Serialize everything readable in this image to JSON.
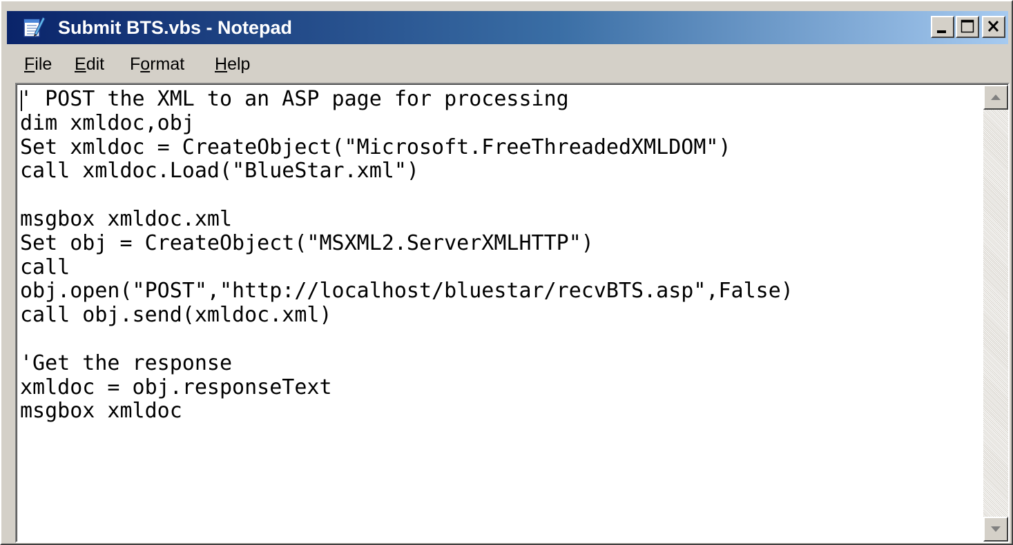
{
  "window": {
    "title": "Submit BTS.vbs - Notepad",
    "title_bar_colors": [
      "#0a246a",
      "#a6caf0"
    ],
    "icon": "notepad-icon",
    "controls": {
      "minimize_icon": "minimize-icon",
      "maximize_icon": "maximize-icon",
      "close_icon": "close-icon"
    }
  },
  "menu": {
    "items": [
      {
        "mnemonic": "F",
        "rest": "ile"
      },
      {
        "mnemonic": "E",
        "rest": "dit"
      },
      {
        "pre": "F",
        "mnemonic": "o",
        "rest": "rmat"
      },
      {
        "mnemonic": "H",
        "rest": "elp"
      }
    ]
  },
  "editor": {
    "lines": [
      "' POST the XML to an ASP page for processing",
      "dim xmldoc,obj",
      "Set xmldoc = CreateObject(\"Microsoft.FreeThreadedXMLDOM\")",
      "call xmldoc.Load(\"BlueStar.xml\")",
      "",
      "msgbox xmldoc.xml",
      "Set obj = CreateObject(\"MSXML2.ServerXMLHTTP\")",
      "call",
      "obj.open(\"POST\",\"http://localhost/bluestar/recvBTS.asp\",False)",
      "call obj.send(xmldoc.xml)",
      "",
      "'Get the response",
      "xmldoc = obj.responseText",
      "msgbox xmldoc"
    ]
  },
  "scrollbar": {
    "up_icon": "scroll-up-arrow-icon",
    "down_icon": "scroll-down-arrow-icon"
  }
}
